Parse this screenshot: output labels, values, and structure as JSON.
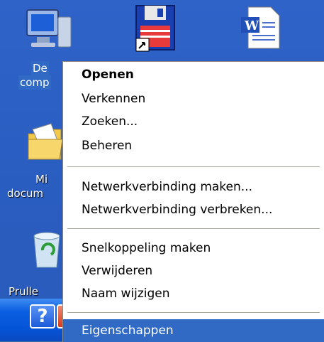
{
  "desktop": {
    "icons": [
      {
        "id": "my-computer",
        "label_line1": "De",
        "label_line2": "comp"
      },
      {
        "id": "my-documents",
        "label_line1": "Mi",
        "label_line2": "docum"
      },
      {
        "id": "recycle-bin",
        "label_line1": "Prulle"
      }
    ]
  },
  "context_menu": {
    "items": [
      {
        "label": "Openen",
        "bold": true
      },
      {
        "label": "Verkennen"
      },
      {
        "label": "Zoeken..."
      },
      {
        "label": "Beheren"
      },
      {
        "label": "Netwerkverbinding maken..."
      },
      {
        "label": "Netwerkverbinding verbreken..."
      },
      {
        "label": "Snelkoppeling maken"
      },
      {
        "label": "Verwijderen"
      },
      {
        "label": "Naam wijzigen"
      },
      {
        "label": "Eigenschappen"
      }
    ]
  },
  "window_buttons": {
    "help": "?",
    "close": "✕"
  },
  "colors": {
    "desktop": "#2f63c8",
    "selection": "#316ac5",
    "close_red": "#e0452c"
  }
}
